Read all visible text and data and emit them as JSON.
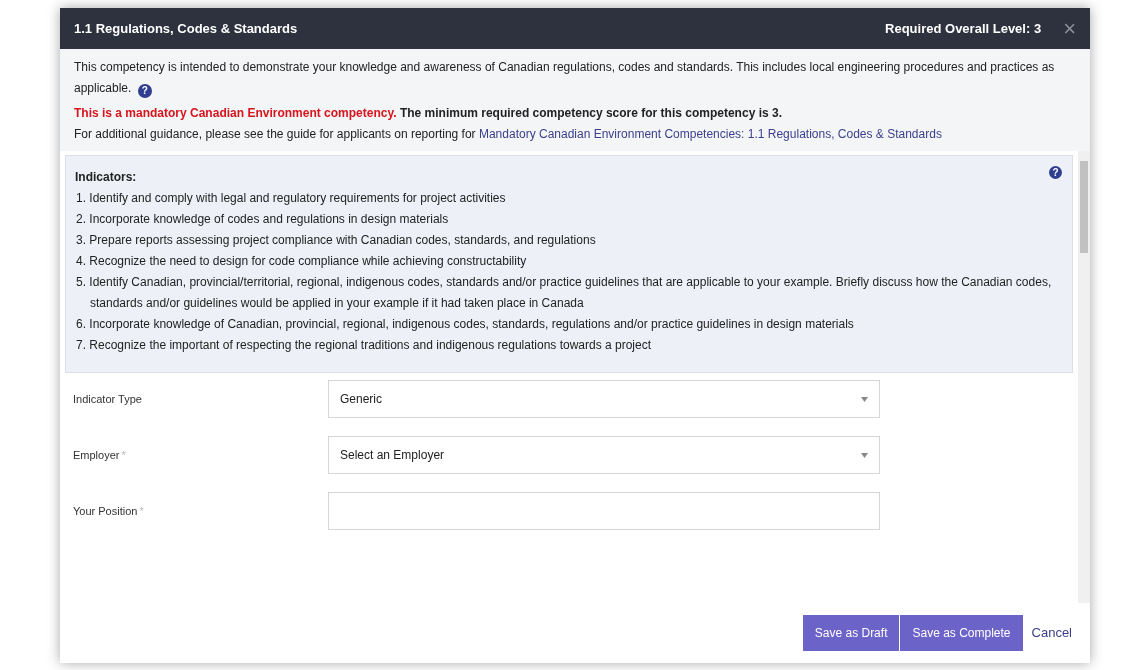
{
  "dialog": {
    "title": "1.1 Regulations, Codes & Standards",
    "required_level": "Required Overall Level: 3",
    "close": "×"
  },
  "intro": "This competency is intended to demonstrate your knowledge and awareness of Canadian regulations, codes and standards. This includes local engineering procedures and practices as applicable.",
  "intro_help": "?",
  "mandatory_notice": {
    "highlight": "This is a mandatory Canadian Environment competency.",
    "text": "The minimum required competency score for this competency is 3."
  },
  "guidance": {
    "text": "For additional guidance, please see the guide for applicants on reporting for",
    "link": "Mandatory Canadian Environment Competencies: 1.1 Regulations, Codes & Standards"
  },
  "indicators": {
    "title": "Indicators:",
    "help": "?",
    "items": [
      "1. Identify and comply with legal and regulatory requirements for project activities",
      "2. Incorporate knowledge of codes and regulations in design materials",
      "3. Prepare reports assessing project compliance with Canadian codes, standards, and regulations",
      "4. Recognize the need to design for code compliance while achieving constructability",
      "5. Identify Canadian, provincial/territorial, regional, indigenous codes, standards and/or practice guidelines that are applicable to your example. Briefly discuss how the Canadian codes, standards and/or guidelines would be applied in your example if it had taken place in Canada",
      "6. Incorporate knowledge of Canadian, provincial, regional, indigenous codes, standards, regulations and/or practice guidelines in design materials",
      "7. Recognize the important of respecting the regional traditions and indigenous regulations towards a project"
    ]
  },
  "fields": [
    {
      "label": "Indicator Type",
      "kind": "select",
      "value": "Generic"
    },
    {
      "label": "Employer",
      "required_mark": "*",
      "kind": "select",
      "value": "Select an Employer"
    },
    {
      "label": "Your Position",
      "required_mark": "*",
      "kind": "text"
    }
  ],
  "buttons": [
    {
      "label": "Save as Draft",
      "kind": "primary"
    },
    {
      "label": "Save as Complete",
      "kind": "primary"
    },
    {
      "label": "Cancel",
      "kind": "link"
    }
  ]
}
